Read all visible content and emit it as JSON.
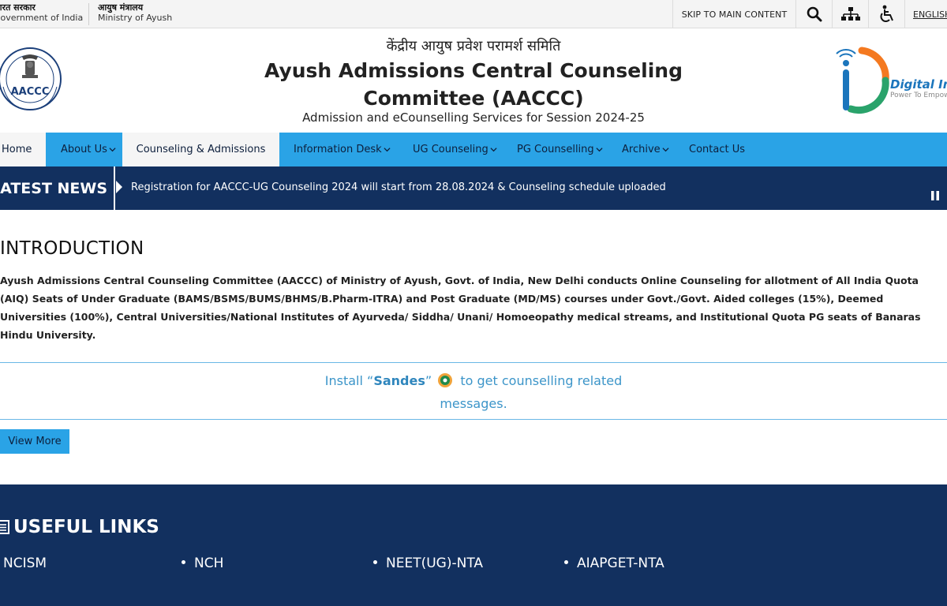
{
  "topbar": {
    "gov_hindi": "भारत सरकार",
    "gov_english": "Government of India",
    "ministry_hindi": "आयुष मंत्रालय",
    "ministry_english": "Ministry of Ayush",
    "skip_label": "SKIP TO MAIN CONTENT",
    "language": "ENGLISH"
  },
  "header": {
    "hindi_title": "केंद्रीय आयुष प्रवेश परामर्श समिति",
    "title_line1": "Ayush Admissions Central Counseling",
    "title_line2": "Committee (AACCC)",
    "subtitle": "Admission and eCounselling Services for Session 2024-25",
    "emblem_text": "AACCC",
    "digital_india": "Digital India",
    "digital_tagline": "Power To Empower"
  },
  "nav": {
    "items": [
      {
        "label": "Home"
      },
      {
        "label": "About Us"
      },
      {
        "label": "Counseling & Admissions"
      },
      {
        "label": "Information Desk"
      },
      {
        "label": "UG Counseling"
      },
      {
        "label": "PG Counselling"
      },
      {
        "label": "Archive"
      },
      {
        "label": "Contact Us"
      }
    ]
  },
  "news": {
    "label": "LATEST NEWS",
    "item": "Registration for AACCC-UG Counseling 2024 will start from 28.08.2024 & Counseling schedule uploaded"
  },
  "intro": {
    "title": "INTRODUCTION",
    "text": "Ayush Admissions Central Counseling Committee (AACCC) of Ministry of Ayush, Govt. of India, New Delhi conducts Online Counseling for allotment of All India Quota (AIQ) Seats of Under Graduate (BAMS/BSMS/BUMS/BHMS/B.Pharm-ITRA) and Post Graduate (MD/MS) courses under Govt./Govt. Aided colleges (15%), Deemed Universities (100%), Central Universities/National Institutes of Ayurveda/ Siddha/ Unani/ Homoeopathy medical streams, and Institutional Quota PG seats of Banaras Hindu University."
  },
  "sandes": {
    "prefix": "Install “",
    "app": "Sandes",
    "quote_close": "”",
    "suffix": " to get counselling related messages."
  },
  "view_more": "View More",
  "useful_links": {
    "title": "USEFUL LINKS",
    "items": [
      "NCISM",
      "NCH",
      "NEET(UG)-NTA",
      "AIAPGET-NTA"
    ]
  },
  "colors": {
    "nav_blue": "#2aa3e6",
    "dark_navy": "#12305f",
    "link_blue": "#3c95c9"
  }
}
